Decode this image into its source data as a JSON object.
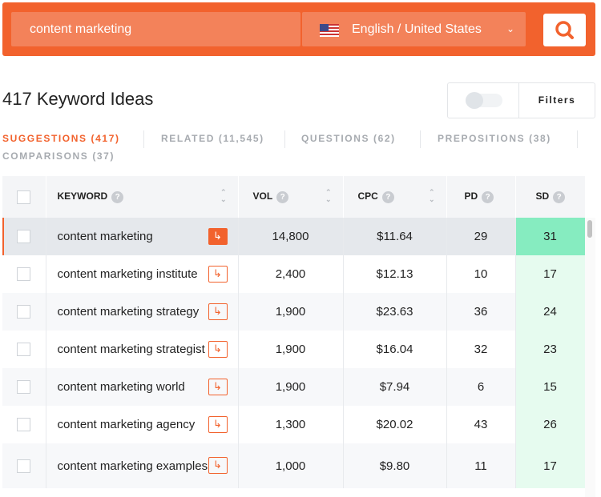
{
  "search": {
    "query": "content marketing",
    "language": "English / United States"
  },
  "heading": "417 Keyword Ideas",
  "filters_label": "Filters",
  "tabs": [
    "SUGGESTIONS (417)",
    "RELATED (11,545)",
    "QUESTIONS (62)",
    "PREPOSITIONS (38)",
    "COMPARISONS (37)"
  ],
  "columns": {
    "keyword": "KEYWORD",
    "vol": "VOL",
    "cpc": "CPC",
    "pd": "PD",
    "sd": "SD"
  },
  "rows": [
    {
      "keyword": "content marketing",
      "vol": "14,800",
      "cpc": "$11.64",
      "pd": "29",
      "sd": "31"
    },
    {
      "keyword": "content marketing institute",
      "vol": "2,400",
      "cpc": "$12.13",
      "pd": "10",
      "sd": "17"
    },
    {
      "keyword": "content marketing strategy",
      "vol": "1,900",
      "cpc": "$23.63",
      "pd": "36",
      "sd": "24"
    },
    {
      "keyword": "content marketing strategist",
      "vol": "1,900",
      "cpc": "$16.04",
      "pd": "32",
      "sd": "23"
    },
    {
      "keyword": "content marketing world",
      "vol": "1,900",
      "cpc": "$7.94",
      "pd": "6",
      "sd": "15"
    },
    {
      "keyword": "content marketing agency",
      "vol": "1,300",
      "cpc": "$20.02",
      "pd": "43",
      "sd": "26"
    },
    {
      "keyword": "content marketing examples",
      "vol": "1,000",
      "cpc": "$9.80",
      "pd": "11",
      "sd": "17"
    }
  ]
}
